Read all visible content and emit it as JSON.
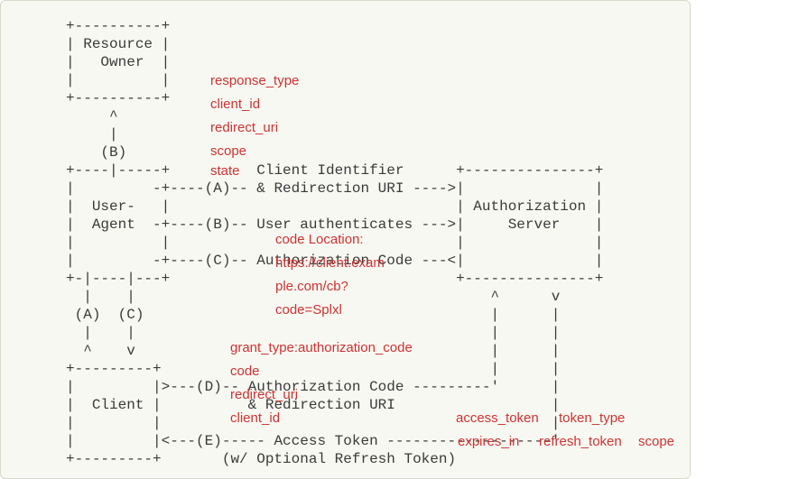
{
  "diagram": {
    "ascii": "     +----------+\n     | Resource |\n     |   Owner  |\n     |          |\n     +----------+\n          ^\n          |\n         (B)\n     +----|-----+          Client Identifier      +---------------+\n     |         -+----(A)-- & Redirection URI ---->|               |\n     |  User-   |                                 | Authorization |\n     |  Agent  -+----(B)-- User authenticates --->|     Server    |\n     |          |                                 |               |\n     |         -+----(C)-- Authorization Code ---<|               |\n     +-|----|---+                                 +---------------+\n       |    |                                         ^      v\n      (A)  (C)                                        |      |\n       |    |                                         |      |\n       ^    v                                         |      |\n     +---------+                                      |      |\n     |         |>---(D)-- Authorization Code ---------'      |\n     |  Client |          & Redirection URI                  |\n     |         |                                             |\n     |         |<---(E)----- Access Token -------------------'\n     +---------+       (w/ Optional Refresh Token)"
  },
  "annotations": {
    "a1": "response_type",
    "a2": "client_id",
    "a3": "redirect_uri",
    "a4": "scope",
    "a5": "state",
    "c1": "code Location:",
    "c2": "https://client.exam",
    "c3": "ple.com/cb?",
    "c4": "code=Splxl",
    "d1": "grant_type:authorization_code",
    "d2": "code",
    "d3": "redirect_uri",
    "d4": "client_id",
    "e1": "access_token",
    "e2": "token_type",
    "e3": "expires_in",
    "e4": "refresh_token",
    "e5": "scope"
  }
}
